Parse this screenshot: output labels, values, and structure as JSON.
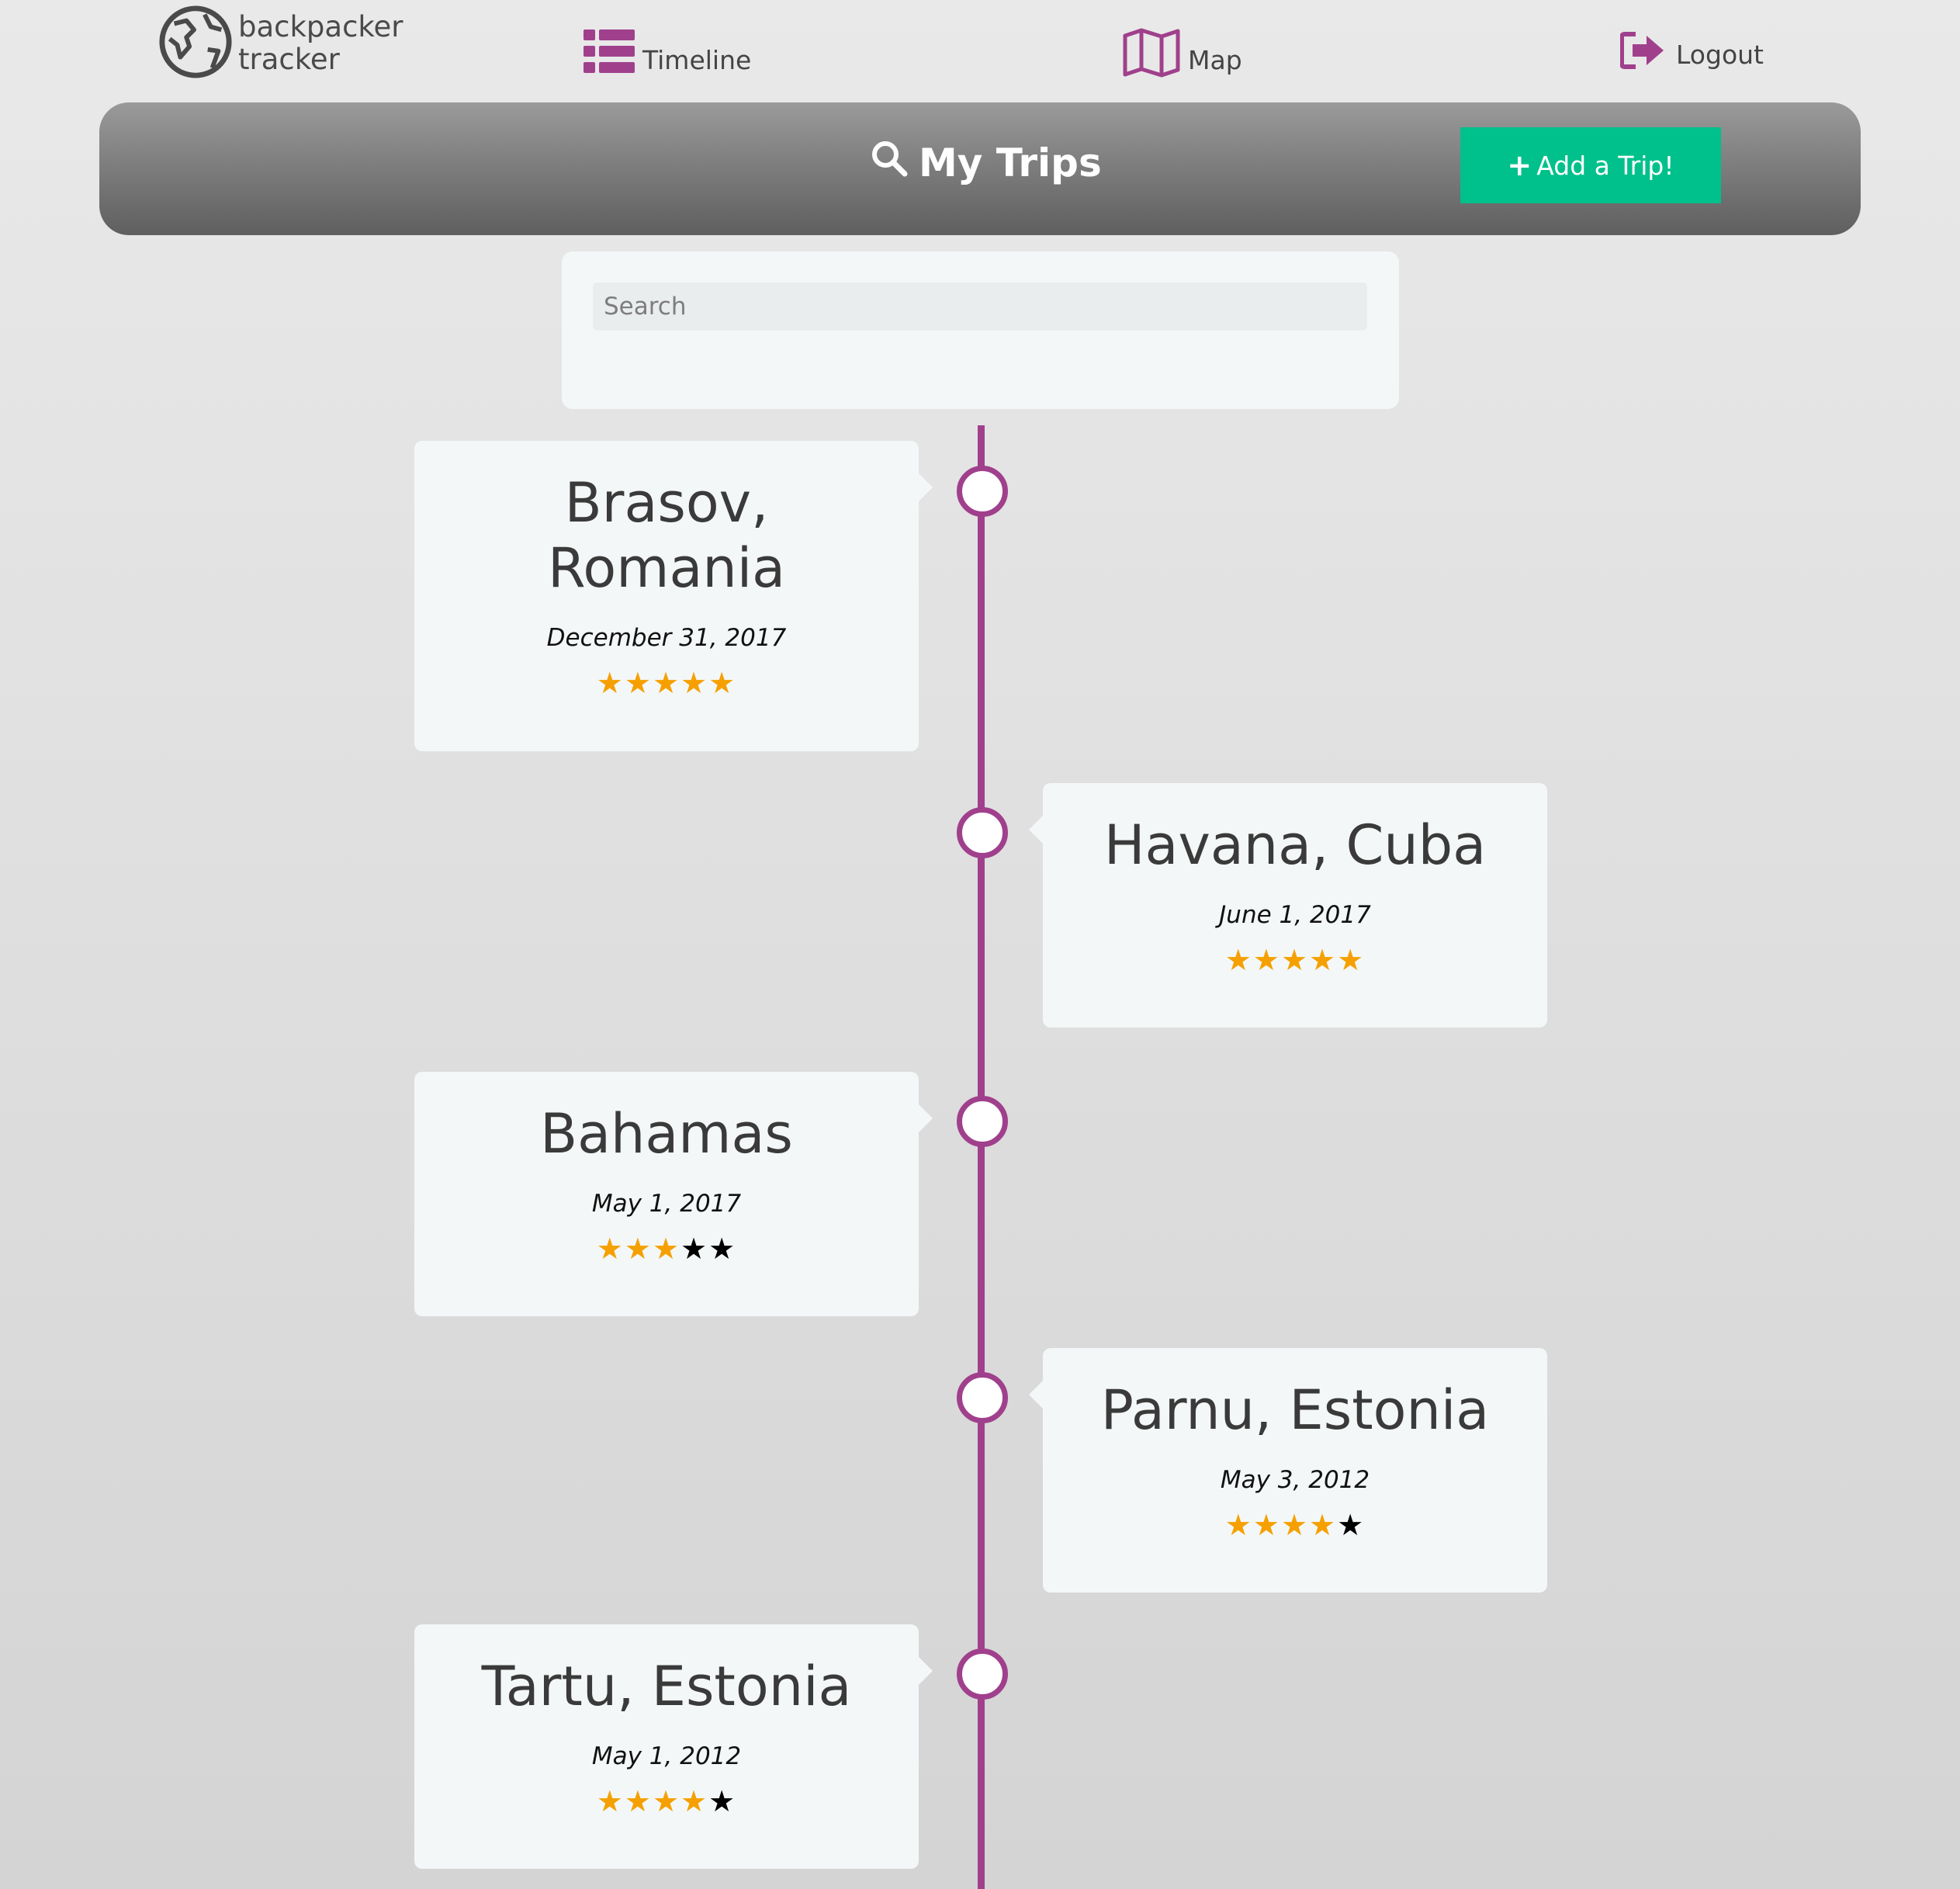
{
  "app": {
    "logo_line1": "backpacker",
    "logo_line2": "tracker"
  },
  "nav": {
    "timeline": "Timeline",
    "map": "Map",
    "logout": "Logout"
  },
  "header": {
    "title": "My Trips",
    "add_trip": "Add a Trip!"
  },
  "search": {
    "placeholder": "Search"
  },
  "colors": {
    "accent": "#a0408c",
    "button": "#00c08b",
    "star_filled": "#f5a000",
    "star_empty": "#000000"
  },
  "trips": [
    {
      "title": "Brasov, Romania",
      "date": "December 31, 2017",
      "rating": 5
    },
    {
      "title": "Havana, Cuba",
      "date": "June 1, 2017",
      "rating": 5
    },
    {
      "title": "Bahamas",
      "date": "May 1, 2017",
      "rating": 3
    },
    {
      "title": "Parnu, Estonia",
      "date": "May 3, 2012",
      "rating": 4
    },
    {
      "title": "Tartu, Estonia",
      "date": "May 1, 2012",
      "rating": 4
    }
  ]
}
